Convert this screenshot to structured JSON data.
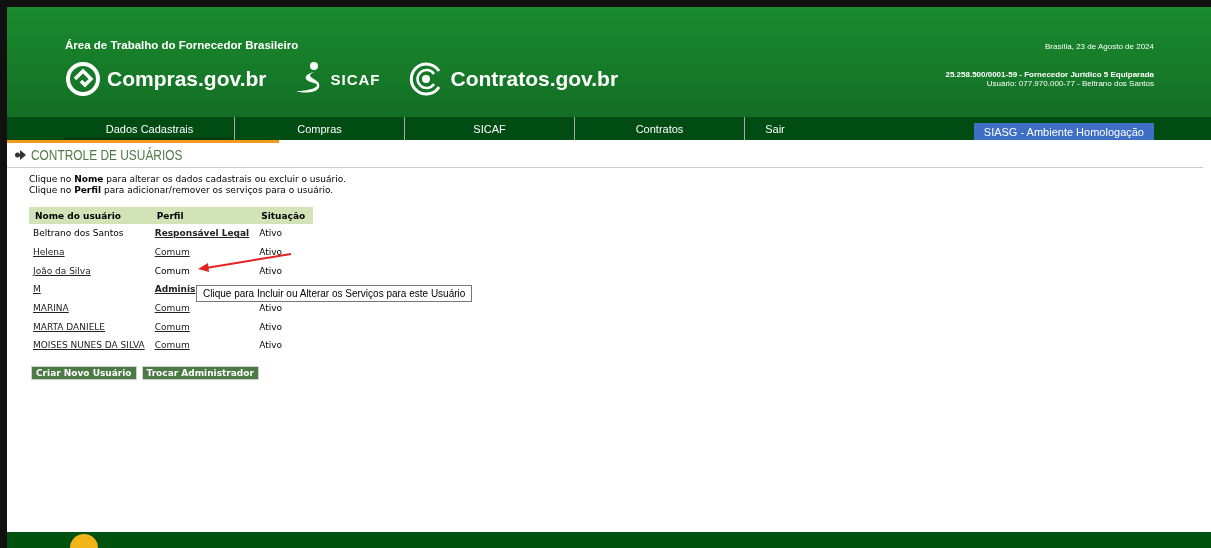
{
  "header": {
    "title": "Área de Trabalho do Fornecedor Brasileiro",
    "logos": [
      {
        "kind": "compras",
        "text": "Compras.gov.br"
      },
      {
        "kind": "sicaf",
        "text": "SICAF"
      },
      {
        "kind": "contratos",
        "text": "Contratos.gov.br"
      }
    ],
    "date": "Brasília, 23 de Agosto de 2024",
    "company": "25.258.500/0001-59 - Fornecedor Jurídico 5 Equiparada",
    "user": "Usuário: 077.970.000-77 - Beltrano dos Santos"
  },
  "nav": {
    "items": [
      {
        "label": "Dados Cadastrais",
        "selected": true
      },
      {
        "label": "Compras",
        "selected": false
      },
      {
        "label": "SICAF",
        "selected": false
      },
      {
        "label": "Contratos",
        "selected": false
      },
      {
        "label": "Sair",
        "selected": false
      }
    ],
    "environment": "SIASG - Ambiente Homologação"
  },
  "section": {
    "title": "CONTROLE DE USUÁRIOS",
    "instructions": [
      "Clique no **Nome** para alterar os dados cadastrais ou excluir o usuário.",
      "Clique no **Perfil** para adicionar/remover os serviços para o usuário."
    ]
  },
  "table": {
    "columns": [
      "Nome do usuário",
      "Perfil",
      "Situação"
    ],
    "rows": [
      {
        "name": "Beltrano dos Santos",
        "name_link": false,
        "profile": "Responsável Legal",
        "profile_link": true,
        "profile_bold": true,
        "status": "Ativo"
      },
      {
        "name": "Helena",
        "name_link": true,
        "profile": "Comum",
        "profile_link": true,
        "profile_bold": false,
        "status": "Ativo"
      },
      {
        "name": "João da Silva",
        "name_link": true,
        "profile": "Comum",
        "profile_link": false,
        "profile_bold": false,
        "status": "Ativo"
      },
      {
        "name": "M",
        "name_link": true,
        "profile": "Adminis",
        "profile_link": true,
        "profile_bold": true
      },
      {
        "name": "MARINA",
        "name_link": true,
        "profile": "Comum",
        "profile_link": true,
        "profile_bold": false,
        "status": "Ativo"
      },
      {
        "name": "MARTA DANIELE",
        "name_link": true,
        "profile": "Comum",
        "profile_link": true,
        "profile_bold": false,
        "status": "Ativo"
      },
      {
        "name": "MOISES NUNES DA SILVA",
        "name_link": true,
        "profile": "Comum",
        "profile_link": true,
        "profile_bold": false,
        "status": "Ativo"
      }
    ]
  },
  "tooltip": "Clique para Incluir ou Alterar os Serviços para este Usuário",
  "buttons": [
    "Criar Novo Usuário",
    "Trocar Administrador"
  ]
}
